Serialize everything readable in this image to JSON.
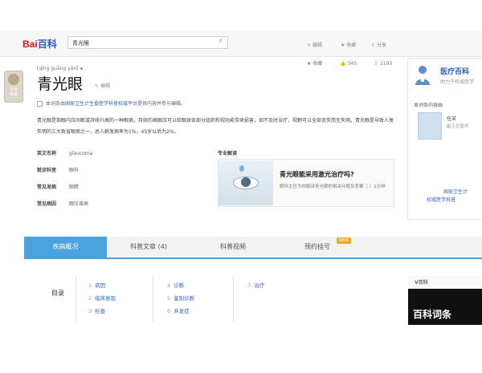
{
  "header": {
    "logo_a": "Bai",
    "logo_b": "百科",
    "search_value": "青光眼",
    "links": [
      "编辑",
      "收藏",
      "分享"
    ]
  },
  "sidebar_float": {
    "label": "专家\n权威"
  },
  "entry": {
    "pinyin": "[qīng guāng yǎn]",
    "title": "青光眼",
    "edit_label": "编辑",
    "stats": {
      "like_label": "收藏",
      "likes": "345",
      "shares": "2193"
    },
    "notice_pre": "本词条由",
    "notice_link": "国家卫生计生委医学科普权威平台",
    "notice_post": "提供内容并参与编辑。",
    "summary": "青光眼是指眼内压间断或持续升高的一种眼病，持续的高眼压可以给眼球各部分组织和视功能带来损害，如不及时治疗，视野可以全部丧失而至失明。青光眼是导致人类失明的三大致盲眼病之一，总人群发病率为1%，45岁以后为2%。",
    "info": [
      {
        "key": "英文名称",
        "value": "glaucoma"
      },
      {
        "key": "就诊科室",
        "value": "眼科"
      },
      {
        "key": "常见发病",
        "value": "眼睛"
      },
      {
        "key": "常见病因",
        "value": "眼压增高"
      }
    ],
    "media_label": "专业解读",
    "video_title": "青光眼能采用激光治疗吗?",
    "video_desc": "眼科主任为你解读青光眼的相关问题及答案（  ）1分钟"
  },
  "side_card": {
    "title": "医疗百科",
    "subtitle": "助力于权威医学",
    "label": "本词条内容由",
    "doctor_name": "任某",
    "doctor_title": "副主任医师",
    "link1": "国家卫生计",
    "link2": "权威医学科普"
  },
  "tabs": [
    {
      "label": "疾病概况"
    },
    {
      "label": "科普文章 (4)"
    },
    {
      "label": "科普视频"
    },
    {
      "label": "预约挂号"
    }
  ],
  "tab_badge": "NEW",
  "toc": {
    "title": "目录",
    "col1": [
      {
        "num": "1",
        "label": "病因"
      },
      {
        "num": "2",
        "label": "临床表现"
      },
      {
        "num": "3",
        "label": "检查"
      }
    ],
    "col2": [
      {
        "num": "4",
        "label": "诊断"
      },
      {
        "num": "5",
        "label": "鉴别诊断"
      },
      {
        "num": "6",
        "label": "并发症"
      }
    ],
    "col3": [
      {
        "num": "7",
        "label": "治疗"
      }
    ]
  },
  "ad": {
    "label": "V百科",
    "text": "百科词条"
  },
  "colors": {
    "accent": "#4aa3df",
    "link": "#3366cc",
    "badge": "#f5a623"
  }
}
